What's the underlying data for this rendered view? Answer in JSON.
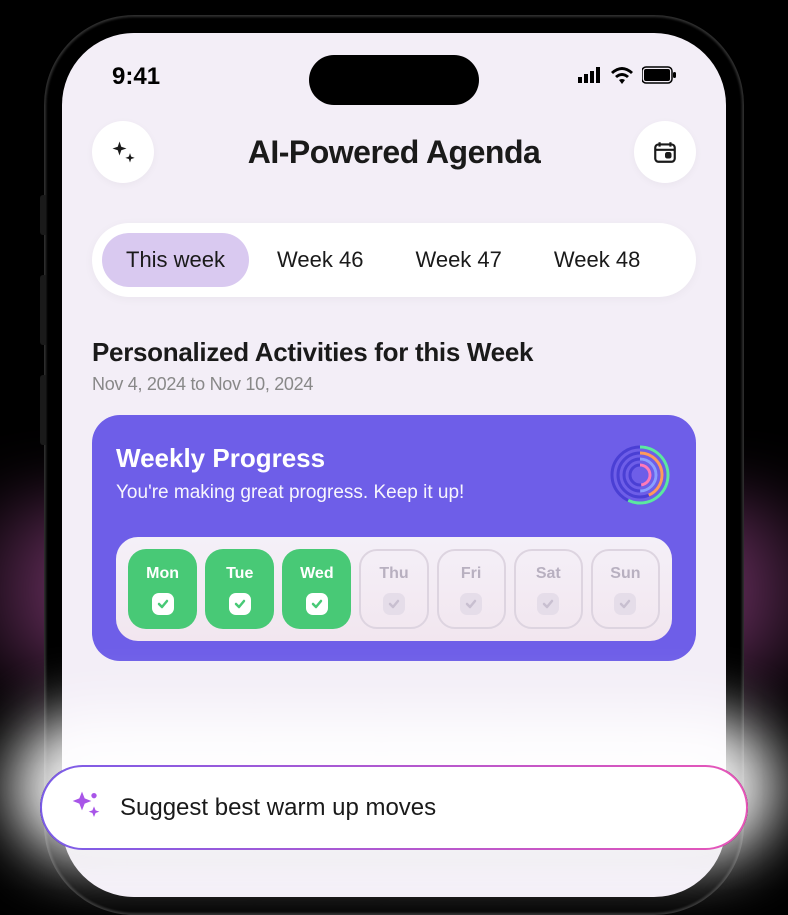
{
  "status": {
    "time": "9:41"
  },
  "header": {
    "title": "AI-Powered Agenda"
  },
  "tabs": {
    "items": [
      {
        "label": "This week",
        "active": true
      },
      {
        "label": "Week 46",
        "active": false
      },
      {
        "label": "Week 47",
        "active": false
      },
      {
        "label": "Week 48",
        "active": false
      }
    ]
  },
  "section": {
    "title": "Personalized Activities for this Week",
    "subtitle": "Nov 4, 2024 to Nov 10, 2024"
  },
  "progress": {
    "title": "Weekly Progress",
    "subtitle": "You're making great progress. Keep it up!",
    "days": [
      {
        "label": "Mon",
        "done": true
      },
      {
        "label": "Tue",
        "done": true
      },
      {
        "label": "Wed",
        "done": true
      },
      {
        "label": "Thu",
        "done": false
      },
      {
        "label": "Fri",
        "done": false
      },
      {
        "label": "Sat",
        "done": false
      },
      {
        "label": "Sun",
        "done": false
      }
    ]
  },
  "suggest": {
    "text": "Suggest best warm up moves"
  }
}
